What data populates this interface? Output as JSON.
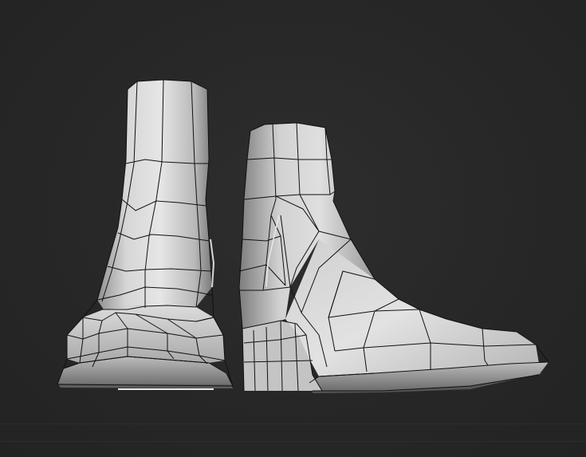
{
  "viewport": {
    "background": "#262626",
    "mesh_color": "#c9c9c9",
    "edge_color": "#111111"
  },
  "models": [
    {
      "name": "left-boot",
      "view": "front"
    },
    {
      "name": "right-boot",
      "view": "side"
    }
  ]
}
